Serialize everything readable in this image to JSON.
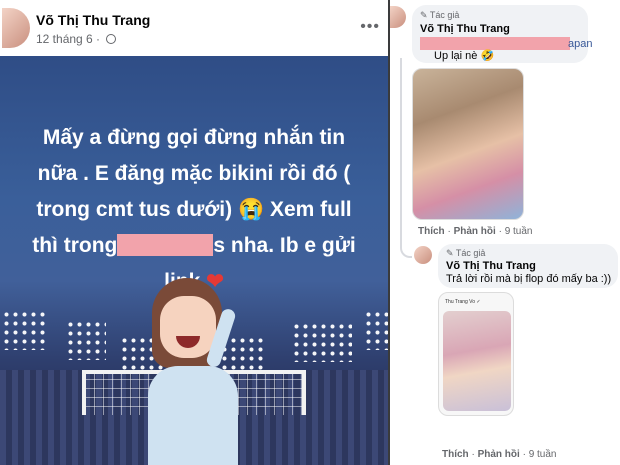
{
  "post": {
    "author": "Võ Thị Thu Trang",
    "date": "12 tháng 6 ·",
    "more_icon": "more-horizontal-icon",
    "privacy_icon": "globe-icon",
    "text_lines": [
      "Mấy a đừng gọi đừng nhắn tin",
      "nữa . E đăng mặc bikini rồi đó (",
      "trong cmt tus dưới) 😭 Xem full",
      "thì trong",
      "s nha. Ib e gửi",
      "link"
    ],
    "heart": "❤",
    "background_color": "#3a5f9a"
  },
  "comments": [
    {
      "badge": "✎ Tác giả",
      "author": "Võ Thị Thu Trang",
      "link_suffix": "apan",
      "text": "Up lại nè 🤣",
      "actions": {
        "like": "Thích",
        "reply": "Phản hồi",
        "time": "9 tuần"
      }
    },
    {
      "badge": "✎ Tác giả",
      "author": "Võ Thị Thu Trang",
      "text": "Trả lời rồi mà bị flop đó mấy ba :))",
      "inner_caption": "Thu Trang Vo ✓",
      "actions": {
        "like": "Thích",
        "reply": "Phản hồi",
        "time": "9 tuần"
      }
    }
  ],
  "colors": {
    "redaction": "#f2a3ab",
    "link": "#385898"
  }
}
